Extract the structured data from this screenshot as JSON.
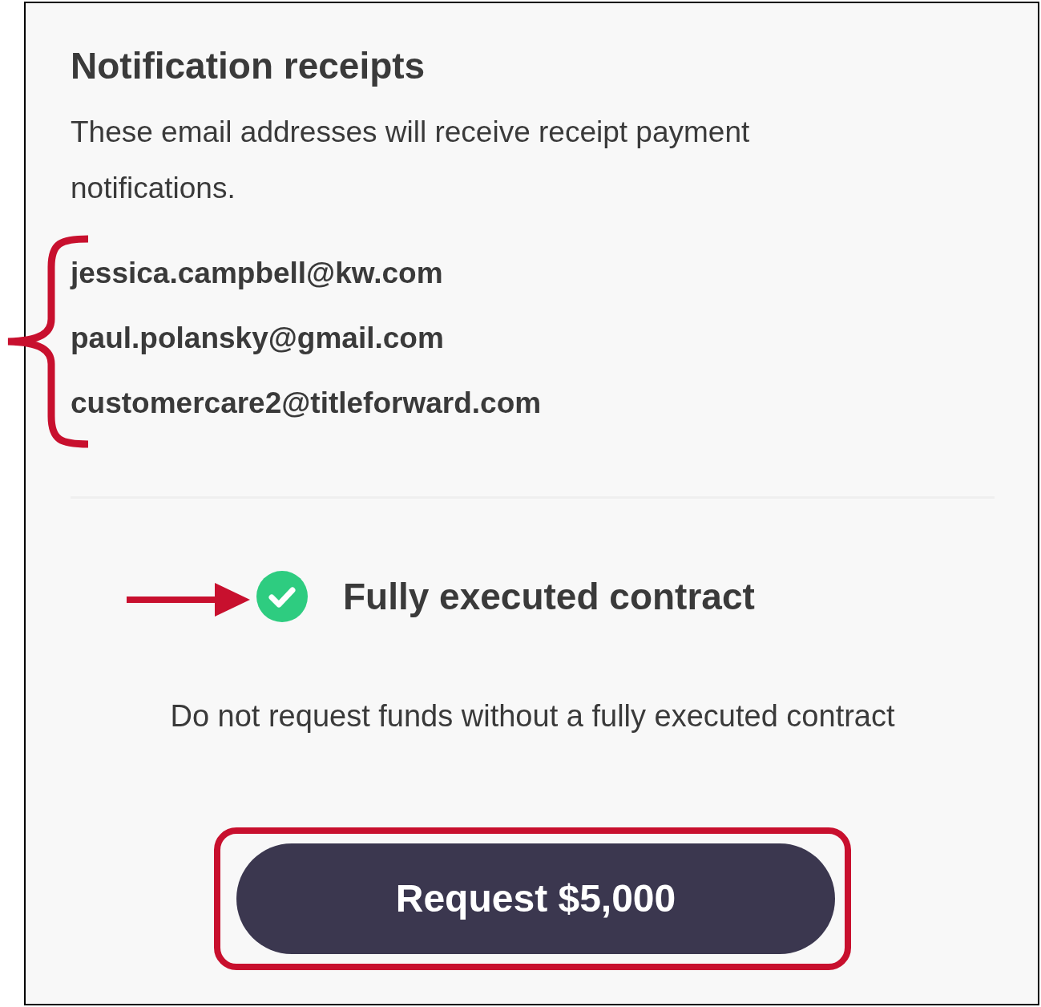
{
  "title": "Notification receipts",
  "description": "These email addresses will receive receipt payment notifications.",
  "emails": [
    "jessica.campbell@kw.com",
    "paul.polansky@gmail.com",
    "customercare2@titleforward.com"
  ],
  "contract": {
    "label": "Fully executed contract",
    "checked": true
  },
  "warning": "Do not request funds without a fully executed contract",
  "button": "Request $5,000"
}
